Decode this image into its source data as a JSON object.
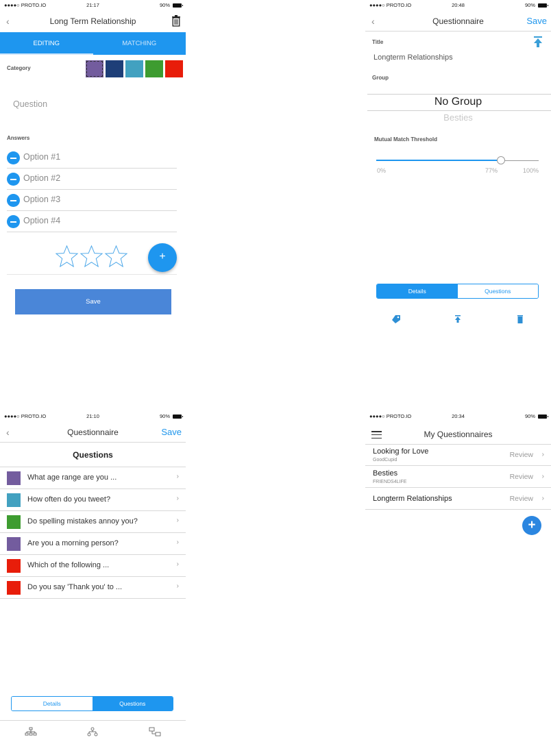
{
  "colors": {
    "primary": "#1e96ef",
    "save_button": "#4a86d8",
    "purple": "#735c9e",
    "navy": "#1e3f78",
    "teal": "#42a1c0",
    "green": "#3e9c30",
    "red": "#e81d0a"
  },
  "screen1": {
    "status": {
      "carrier": "●●●●○ PROTO.IO",
      "time": "21:17",
      "battery": "90%"
    },
    "nav_title": "Long Term Relationship",
    "tabs": [
      "EDITING",
      "MATCHING"
    ],
    "category_label": "Category",
    "category_swatches": [
      "#735c9e",
      "#1e3f78",
      "#42a1c0",
      "#3e9c30",
      "#e81d0a"
    ],
    "selected_category_index": 0,
    "question_placeholder": "Question",
    "answers_label": "Answers",
    "options": [
      "Option #1",
      "Option #2",
      "Option #3",
      "Option #4"
    ],
    "stars": 3,
    "add_label": "+",
    "save_label": "Save"
  },
  "screen2": {
    "status": {
      "carrier": "●●●●○ PROTO.IO",
      "time": "20:48",
      "battery": "90%"
    },
    "nav_title": "Questionnaire",
    "nav_save": "Save",
    "title_label": "Title",
    "title_value": "Longterm Relationships",
    "group_label": "Group",
    "group_selected": "No Group",
    "group_next": "Besties",
    "threshold_label": "Mutual Match Threshold",
    "threshold_value": 0.77,
    "threshold_min": "0%",
    "threshold_current": "77%",
    "threshold_max": "100%",
    "segments": [
      "Details",
      "Questions"
    ],
    "active_segment": 0
  },
  "screen3": {
    "status": {
      "carrier": "●●●●○ PROTO.IO",
      "time": "21:10",
      "battery": "90%"
    },
    "nav_title": "Questionnaire",
    "nav_save": "Save",
    "section_title": "Questions",
    "questions": [
      {
        "text": "What age range are you ...",
        "color": "#735c9e"
      },
      {
        "text": "How often do you tweet?",
        "color": "#42a1c0"
      },
      {
        "text": "Do spelling mistakes annoy you?",
        "color": "#3e9c30"
      },
      {
        "text": "Are you a morning person?",
        "color": "#735c9e"
      },
      {
        "text": "Which of the following ...",
        "color": "#e81d0a"
      },
      {
        "text": "Do you say 'Thank you' to ...",
        "color": "#e81d0a"
      }
    ],
    "segments": [
      "Details",
      "Questions"
    ],
    "active_segment": 1
  },
  "screen4": {
    "status": {
      "carrier": "●●●●○ PROTO.IO",
      "time": "20:34",
      "battery": "90%"
    },
    "nav_title": "My Questionnaires",
    "items": [
      {
        "name": "Looking for Love",
        "sub": "GoodCupid",
        "action": "Review"
      },
      {
        "name": "Besties",
        "sub": "FRIENDS4LIFE",
        "action": "Review"
      },
      {
        "name": "Longterm Relationships",
        "sub": "",
        "action": "Review"
      }
    ],
    "add_label": "+"
  }
}
